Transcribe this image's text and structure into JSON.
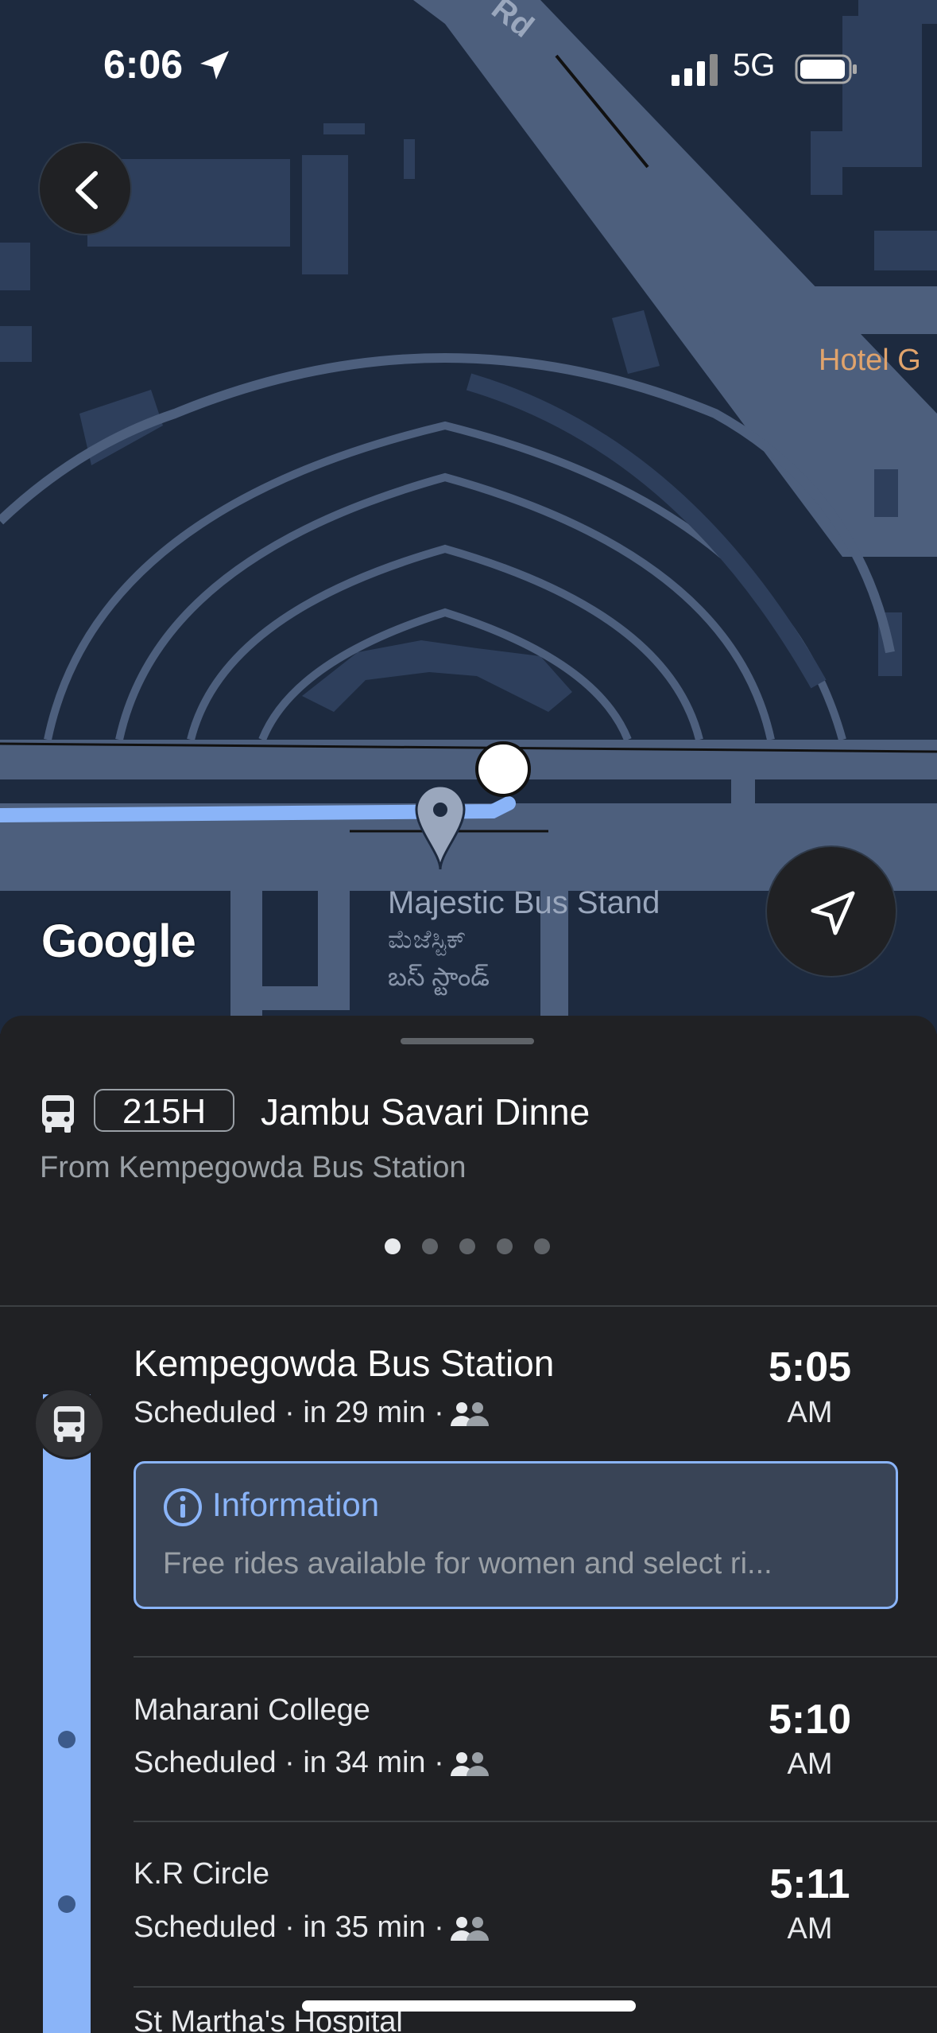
{
  "status_bar": {
    "time": "6:06",
    "network": "5G"
  },
  "map": {
    "labels": {
      "road_partial": "Rd",
      "hotel": "Hotel G",
      "stop_en": "Majestic Bus Stand",
      "stop_kn": "ಮೆಜೆಸ್ಟಿಕ್",
      "stop_te": "బస్ స్టాండ్"
    },
    "attribution": "Google"
  },
  "route": {
    "number": "215H",
    "destination": "Jambu Savari Dinne",
    "from": "From Kempegowda Bus Station",
    "page_count": 5,
    "active_page": 1
  },
  "stops": [
    {
      "name": "Kempegowda Bus Station",
      "status": "Scheduled · in 29 min ·",
      "time": "5:05",
      "ampm": "AM"
    },
    {
      "name": "Maharani College",
      "status": "Scheduled · in 34 min ·",
      "time": "5:10",
      "ampm": "AM"
    },
    {
      "name": "K.R Circle",
      "status": "Scheduled · in 35 min ·",
      "time": "5:11",
      "ampm": "AM"
    },
    {
      "name": "St Martha's Hospital"
    }
  ],
  "info": {
    "title": "Information",
    "text": "Free rides available for women and select ri..."
  },
  "colors": {
    "accent": "#8ab4f8",
    "map_bg": "#1d2a3f",
    "sheet_bg": "#202124"
  }
}
